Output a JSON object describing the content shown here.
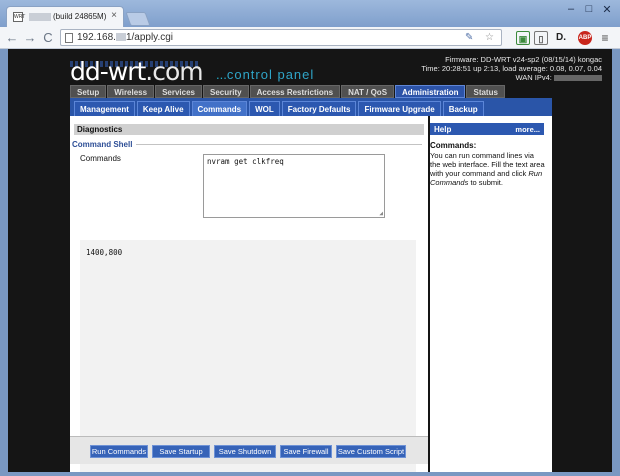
{
  "browser": {
    "tab_favicon": "WRT",
    "tab_title": "(build 24865M)",
    "tab_close": "×",
    "url": "192.168.",
    "url_tail": "1/apply.cgi",
    "minimize": "–",
    "maximize": "□",
    "close": "✕",
    "back": "←",
    "forward": "→",
    "reload": "C",
    "menu": "≡"
  },
  "header": {
    "logo_main": "dd-wrt",
    "logo_dotcom": ".com",
    "subtitle_dots": "...",
    "subtitle": "control panel",
    "firmware": "Firmware: DD-WRT v24-sp2 (08/15/14) kongac",
    "time": "Time: 20:28:51 up 2:13, load average: 0.08, 0.07, 0.04",
    "wan": "WAN IPv4:"
  },
  "main_tabs": [
    "Setup",
    "Wireless",
    "Services",
    "Security",
    "Access Restrictions",
    "NAT / QoS",
    "Administration",
    "Status"
  ],
  "main_tab_active": "Administration",
  "sub_tabs": [
    "Management",
    "Keep Alive",
    "Commands",
    "WOL",
    "Factory Defaults",
    "Firmware Upgrade",
    "Backup"
  ],
  "sub_tab_active": "Commands",
  "content": {
    "section_title": "Diagnostics",
    "legend": "Command Shell",
    "commands_label": "Commands",
    "commands_value": "nvram get clkfreq",
    "output": "1400,800"
  },
  "buttons": [
    "Run Commands",
    "Save Startup",
    "Save Shutdown",
    "Save Firewall",
    "Save Custom Script"
  ],
  "help": {
    "title": "Help",
    "more": "more...",
    "subtitle": "Commands:",
    "text_1": "You can run command lines via the web interface. Fill the text area with your command and click ",
    "text_em": "Run Commands",
    "text_2": " to submit."
  },
  "colors": {
    "accent": "#2c58b0",
    "page_bg": "#151515"
  }
}
